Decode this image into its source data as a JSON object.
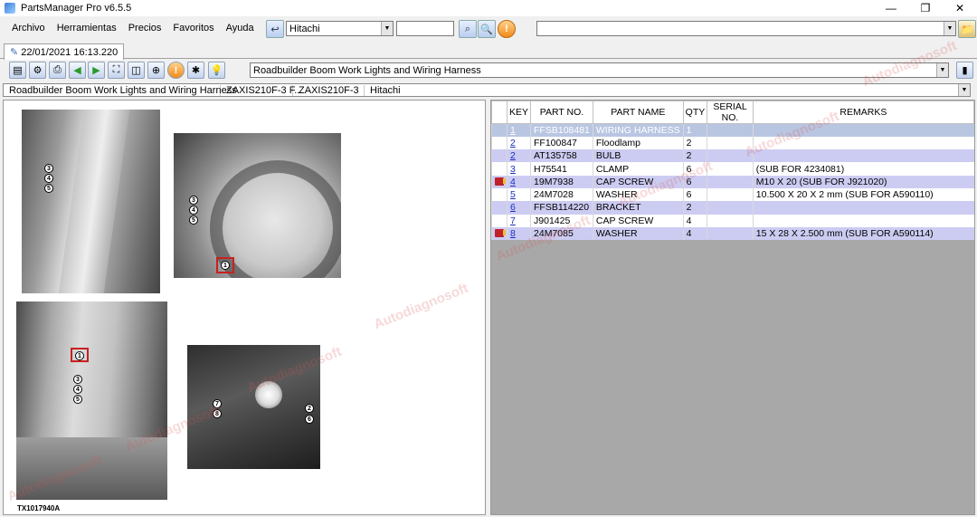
{
  "window": {
    "title": "PartsManager Pro v6.5.5",
    "minimize": "—",
    "maximize": "❐",
    "close": "✕"
  },
  "menu": [
    "Archivo",
    "Herramientas",
    "Precios",
    "Favoritos",
    "Ayuda"
  ],
  "toolbar": {
    "brand_value": "Hitachi",
    "search_value": "",
    "model_value": ""
  },
  "tab": {
    "label": "22/01/2021 16:13.220"
  },
  "section_combo": {
    "value": "Roadbuilder Boom Work Lights and Wiring Harness"
  },
  "breadcrumb": [
    "Roadbuilder Boom Work Lights and Wiring Harness",
    "ZAXIS210F-3 F...",
    "ZAXIS210F-3",
    "Hitachi"
  ],
  "figure": {
    "code": "TX1017940A",
    "callouts": {
      "a": [
        "3",
        "4",
        "5"
      ],
      "b": [
        "3",
        "4",
        "5",
        "1"
      ],
      "c": [
        "1",
        "3",
        "4",
        "5"
      ],
      "d": [
        "7",
        "8",
        "2",
        "6"
      ]
    }
  },
  "watermark_text": "Autodiagnosoft",
  "table": {
    "columns": [
      "KEY",
      "PART NO.",
      "PART NAME",
      "QTY",
      "SERIAL NO.",
      "REMARKS"
    ],
    "rows": [
      {
        "flag": false,
        "key": "1",
        "part_no": "FFSB108481",
        "name": "WIRING HARNESS",
        "qty": "1",
        "serial": "",
        "remarks": ""
      },
      {
        "flag": false,
        "key": "2",
        "part_no": "FF100847",
        "name": "Floodlamp",
        "qty": "2",
        "serial": "",
        "remarks": ""
      },
      {
        "flag": false,
        "key": "2",
        "part_no": "AT135758",
        "name": "BULB",
        "qty": "2",
        "serial": "",
        "remarks": ""
      },
      {
        "flag": false,
        "key": "3",
        "part_no": "H75541",
        "name": "CLAMP",
        "qty": "6",
        "serial": "",
        "remarks": "(SUB FOR 4234081)"
      },
      {
        "flag": true,
        "key": "4",
        "part_no": "19M7938",
        "name": "CAP SCREW",
        "qty": "6",
        "serial": "",
        "remarks": "M10 X 20 (SUB FOR J921020)"
      },
      {
        "flag": false,
        "key": "5",
        "part_no": "24M7028",
        "name": "WASHER",
        "qty": "6",
        "serial": "",
        "remarks": "10.500 X 20 X 2 mm (SUB FOR A590110)"
      },
      {
        "flag": false,
        "key": "6",
        "part_no": "FFSB114220",
        "name": "BRACKET",
        "qty": "2",
        "serial": "",
        "remarks": ""
      },
      {
        "flag": false,
        "key": "7",
        "part_no": "J901425",
        "name": "CAP SCREW",
        "qty": "4",
        "serial": "",
        "remarks": ""
      },
      {
        "flag": true,
        "key": "8",
        "part_no": "24M7085",
        "name": "WASHER",
        "qty": "4",
        "serial": "",
        "remarks": "15 X 28 X 2.500 mm (SUB FOR A590114)"
      }
    ]
  },
  "colors": {
    "row_even": "#ccccf2",
    "row_selected": "#b9c6e2",
    "link": "#1a2fbf"
  }
}
